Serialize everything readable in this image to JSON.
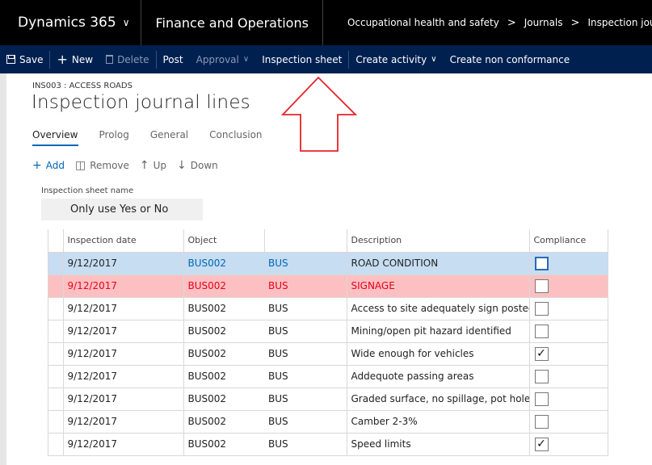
{
  "topbar": {
    "app_name": "Dynamics 365",
    "module": "Finance and Operations",
    "breadcrumb": [
      "Occupational health and safety",
      "Journals",
      "Inspection journal"
    ],
    "breadcrumb_sep": ">"
  },
  "actions": {
    "save": "Save",
    "new": "New",
    "delete": "Delete",
    "post": "Post",
    "approval": "Approval",
    "inspection_sheet": "Inspection sheet",
    "create_activity": "Create activity",
    "create_non_conformance": "Create non conformance"
  },
  "header": {
    "caption": "INS003 : ACCESS ROADS",
    "title": "Inspection journal lines"
  },
  "tabs": [
    "Overview",
    "Prolog",
    "General",
    "Conclusion"
  ],
  "active_tab": "Overview",
  "line_actions": {
    "add": "Add",
    "remove": "Remove",
    "up": "Up",
    "down": "Down"
  },
  "inspection_sheet_field": {
    "label": "Inspection sheet name",
    "value": "Only use Yes or No"
  },
  "grid": {
    "columns": {
      "date": "Inspection date",
      "object": "Object",
      "description": "Description",
      "compliance": "Compliance"
    },
    "rows": [
      {
        "date": "9/12/2017",
        "object": "BUS002",
        "type": "BUS",
        "description": "ROAD CONDITION",
        "compliance": false,
        "state": "selected"
      },
      {
        "date": "9/12/2017",
        "object": "BUS002",
        "type": "BUS",
        "description": "SIGNAGE",
        "compliance": false,
        "state": "error"
      },
      {
        "date": "9/12/2017",
        "object": "BUS002",
        "type": "BUS",
        "description": "Access to site adequately sign posted",
        "compliance": false,
        "state": "normal"
      },
      {
        "date": "9/12/2017",
        "object": "BUS002",
        "type": "BUS",
        "description": "Mining/open pit hazard identified",
        "compliance": false,
        "state": "normal"
      },
      {
        "date": "9/12/2017",
        "object": "BUS002",
        "type": "BUS",
        "description": "Wide enough for vehicles",
        "compliance": true,
        "state": "normal"
      },
      {
        "date": "9/12/2017",
        "object": "BUS002",
        "type": "BUS",
        "description": "Addequote passing areas",
        "compliance": false,
        "state": "normal"
      },
      {
        "date": "9/12/2017",
        "object": "BUS002",
        "type": "BUS",
        "description": "Graded surface, no spillage, pot holes",
        "compliance": false,
        "state": "normal"
      },
      {
        "date": "9/12/2017",
        "object": "BUS002",
        "type": "BUS",
        "description": "Camber 2-3%",
        "compliance": false,
        "state": "normal"
      },
      {
        "date": "9/12/2017",
        "object": "BUS002",
        "type": "BUS",
        "description": "Speed limits",
        "compliance": true,
        "state": "normal"
      }
    ]
  },
  "colors": {
    "topbar": "#000000",
    "actionbar": "#002050",
    "accent": "#0066b4",
    "selected_row": "#c7ddf2",
    "error_row": "#fdc0c2",
    "error_text": "#e8001c",
    "annotation_arrow": "#e8232a"
  }
}
